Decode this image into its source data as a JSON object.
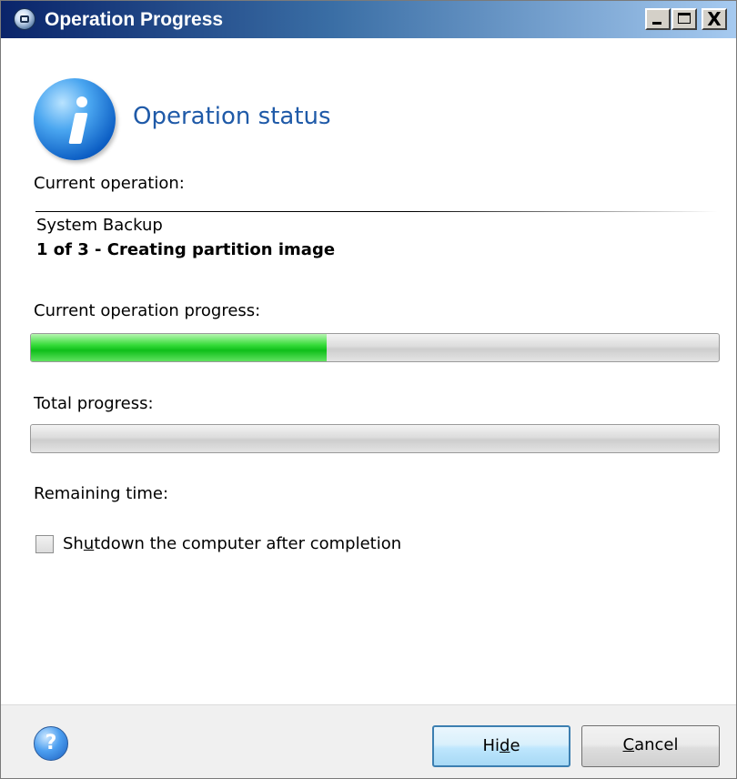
{
  "window": {
    "title": "Operation Progress",
    "icons": {
      "app": "app-icon",
      "minimize": "minimize-icon",
      "maximize": "maximize-icon",
      "close": "close-icon"
    },
    "close_glyph": "X"
  },
  "header": {
    "icon": "info-icon",
    "title": "Operation status"
  },
  "current_operation": {
    "label": "Current operation:",
    "name": "System Backup",
    "step": "1 of 3 - Creating partition image"
  },
  "current_progress": {
    "label": "Current operation progress:",
    "value": 0.43
  },
  "total_progress": {
    "label": "Total progress:",
    "value": 0.0
  },
  "remaining_time": {
    "label": "Remaining time:"
  },
  "shutdown_option": {
    "label_prefix": "Sh",
    "label_accel": "u",
    "label_suffix": "tdown the computer after completion",
    "checked": false
  },
  "footer": {
    "help_icon": "help-icon",
    "help_glyph": "?",
    "hide_button": {
      "prefix": "Hi",
      "accel": "d",
      "suffix": "e"
    },
    "cancel_button": {
      "prefix": "",
      "accel": "C",
      "suffix": "ancel"
    }
  },
  "colors": {
    "title_bar": "#0a246a",
    "heading": "#1f5aa8",
    "progress_fill": "#37dc3a"
  }
}
